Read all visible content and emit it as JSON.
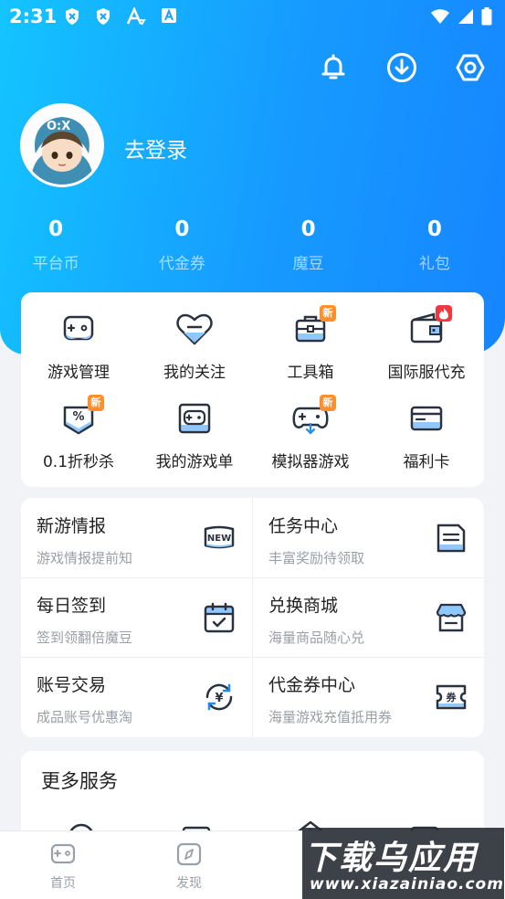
{
  "status_bar": {
    "time": "2:31"
  },
  "profile": {
    "login_label": "去登录"
  },
  "stats": [
    {
      "value": "0",
      "label": "平台币"
    },
    {
      "value": "0",
      "label": "代金券"
    },
    {
      "value": "0",
      "label": "魔豆"
    },
    {
      "value": "0",
      "label": "礼包"
    }
  ],
  "grid": [
    {
      "label": "游戏管理",
      "icon": "gamepad-icon"
    },
    {
      "label": "我的关注",
      "icon": "heart-icon"
    },
    {
      "label": "工具箱",
      "icon": "toolbox-icon",
      "badge": "新"
    },
    {
      "label": "国际服代充",
      "icon": "wallet-icon",
      "badge": "🔥"
    },
    {
      "label": "0.1折秒杀",
      "icon": "discount-icon",
      "badge": "新"
    },
    {
      "label": "我的游戏单",
      "icon": "game-list-icon"
    },
    {
      "label": "模拟器游戏",
      "icon": "emulator-icon",
      "badge": "新"
    },
    {
      "label": "福利卡",
      "icon": "card-icon"
    }
  ],
  "services": [
    {
      "title": "新游情报",
      "subtitle": "游戏情报提前知",
      "icon": "new-icon",
      "icon_text": "NEW"
    },
    {
      "title": "任务中心",
      "subtitle": "丰富奖励待领取",
      "icon": "task-icon"
    },
    {
      "title": "每日签到",
      "subtitle": "签到领翻倍魔豆",
      "icon": "calendar-check-icon"
    },
    {
      "title": "兑换商城",
      "subtitle": "海量商品随心兑",
      "icon": "shop-icon"
    },
    {
      "title": "账号交易",
      "subtitle": "成品账号优惠淘",
      "icon": "yen-exchange-icon",
      "icon_text": "¥"
    },
    {
      "title": "代金券中心",
      "subtitle": "海量游戏充值抵用券",
      "icon": "coupon-icon",
      "icon_text": "券"
    }
  ],
  "more": {
    "title": "更多服务"
  },
  "tabs": [
    {
      "label": "首页",
      "icon": "home-gamepad-icon"
    },
    {
      "label": "发现",
      "icon": "compass-icon"
    }
  ],
  "watermark": {
    "big": "下载乌应用",
    "small": "www.xiazainiao.com"
  },
  "colors": {
    "header_start": "#14c4ff",
    "header_end": "#1685ff",
    "accent": "#1a8cff",
    "badge_new": "#ff8f2d",
    "badge_hot": "#f2363b"
  }
}
